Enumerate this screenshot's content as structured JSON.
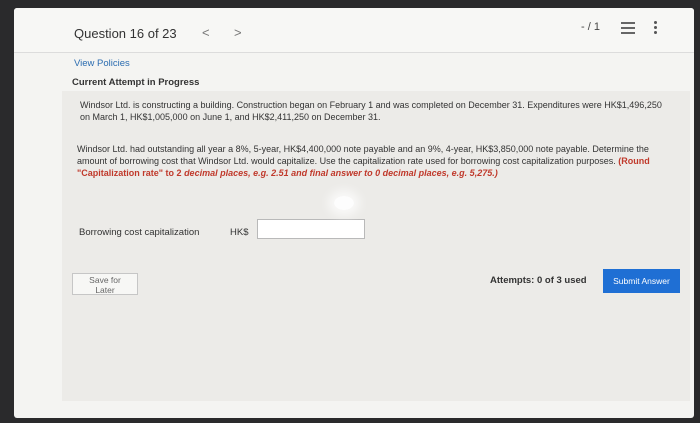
{
  "header": {
    "question_label": "Question 16 of 23",
    "prev_glyph": "<",
    "next_glyph": ">",
    "score": "- / 1"
  },
  "links": {
    "view_policies": "View Policies"
  },
  "status": {
    "current_attempt": "Current Attempt in Progress"
  },
  "question": {
    "paragraph1": "Windsor Ltd. is constructing a building. Construction began on February 1 and was completed on December 31. Expenditures were HK$1,496,250 on March 1, HK$1,005,000 on June 1, and HK$2,411,250 on December 31.",
    "paragraph2_text": "Windsor Ltd. had outstanding all year a 8%, 5-year, HK$4,400,000 note payable and an 9%, 4-year, HK$3,850,000 note payable. Determine the amount of borrowing cost that Windsor Ltd. would capitalize. Use the capitalization rate used for borrowing cost capitalization purposes. ",
    "paragraph2_red_lead": "(Round \"Capitalization rate\" to 2 ",
    "paragraph2_red": "decimal places, e.g. 2.51 and final answer to 0 decimal places, e.g. 5,275.)"
  },
  "answer": {
    "label": "Borrowing cost capitalization",
    "currency": "HK$",
    "value": ""
  },
  "footer": {
    "save_label": "Save for Later",
    "attempts": "Attempts: 0 of 3 used",
    "submit_label": "Submit Answer"
  },
  "colors": {
    "accent": "#1f6fd4",
    "instruction_red": "#c0392b",
    "link_blue": "#2b6cb0"
  }
}
